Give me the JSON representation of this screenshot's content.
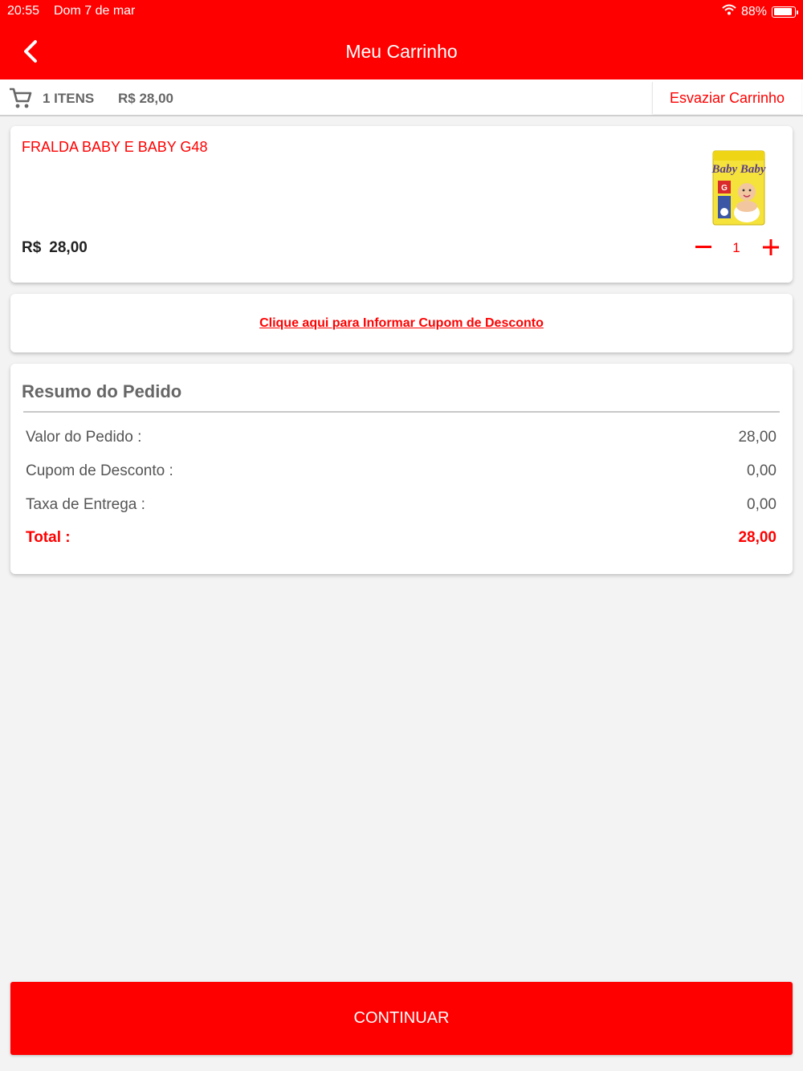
{
  "status_bar": {
    "time": "20:55",
    "date": "Dom 7 de mar",
    "battery": "88%",
    "battery_level": 0.88
  },
  "nav": {
    "title": "Meu Carrinho"
  },
  "cart_bar": {
    "items_count": "1 ITENS",
    "total": "R$ 28,00",
    "empty_label": "Esvaziar Carrinho"
  },
  "product": {
    "name": "FRALDA BABY E BABY G48",
    "currency": "R$",
    "price": "28,00",
    "quantity": "1",
    "image_text": "Baby Baby"
  },
  "coupon": {
    "link_label": "Clique aqui para Informar Cupom de Desconto"
  },
  "summary": {
    "title": "Resumo do Pedido",
    "rows": [
      {
        "label": "Valor do Pedido :",
        "value": "28,00"
      },
      {
        "label": "Cupom de Desconto :",
        "value": "0,00"
      },
      {
        "label": "Taxa de Entrega :",
        "value": "0,00"
      }
    ],
    "total_label": "Total :",
    "total_value": "28,00"
  },
  "footer": {
    "continue_label": "CONTINUAR"
  },
  "colors": {
    "brand": "#ff0000",
    "background": "#f3f3f3",
    "text_muted": "#666666"
  }
}
